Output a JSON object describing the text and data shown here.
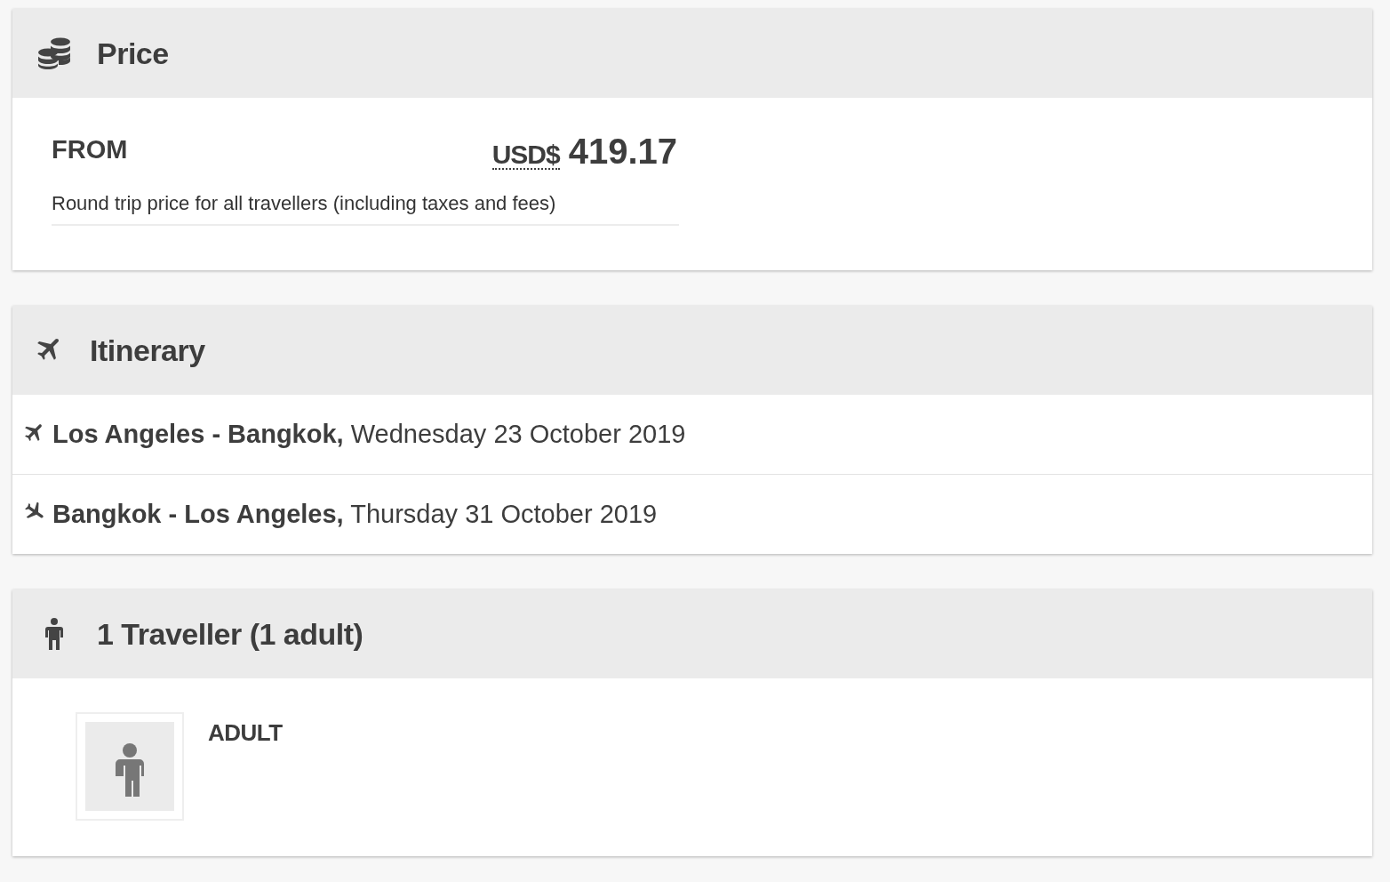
{
  "price": {
    "title": "Price",
    "from_label": "FROM",
    "currency": "USD$",
    "amount": "419.17",
    "note": "Round trip price for all travellers (including taxes and fees)"
  },
  "itinerary": {
    "title": "Itinerary",
    "legs": [
      {
        "kind": "outbound",
        "text": "**Los Angeles - Bangkok,** Wednesday 23 October 2019"
      },
      {
        "kind": "return",
        "text": "**Bangkok - Los Angeles,** Thursday 31 October 2019"
      }
    ]
  },
  "travellers": {
    "title": "1 Traveller (1 adult)",
    "passengers": [
      {
        "type_label": "ADULT"
      }
    ]
  }
}
